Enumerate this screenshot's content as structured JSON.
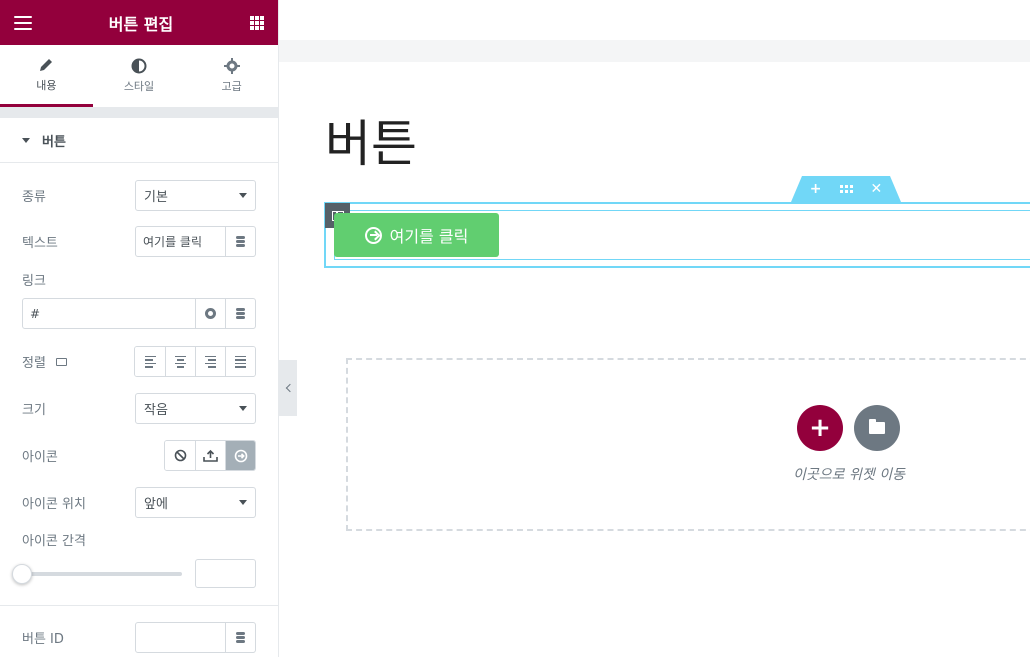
{
  "panel": {
    "title": "버튼 편집",
    "tabs": [
      {
        "label": "내용",
        "icon": "pencil-icon",
        "active": true
      },
      {
        "label": "스타일",
        "icon": "half-circle-icon",
        "active": false
      },
      {
        "label": "고급",
        "icon": "gear-icon",
        "active": false
      }
    ],
    "section_title": "버튼",
    "fields": {
      "type_label": "종류",
      "type_value": "기본",
      "text_label": "텍스트",
      "text_value": "여기를 클릭",
      "link_label": "링크",
      "link_value": "#",
      "align_label": "정렬",
      "size_label": "크기",
      "size_value": "작음",
      "icon_label": "아이콘",
      "icon_position_label": "아이콘 위치",
      "icon_position_value": "앞에",
      "icon_spacing_label": "아이콘 간격",
      "icon_spacing_value": "",
      "button_id_label": "버튼 ID",
      "button_id_value": ""
    }
  },
  "preview": {
    "heading": "버튼",
    "button_text": "여기를 클릭",
    "drop_text": "이곳으로 위젯 이동"
  },
  "colors": {
    "brand": "#93003c",
    "button": "#61ce70",
    "selection": "#71d7f7"
  }
}
